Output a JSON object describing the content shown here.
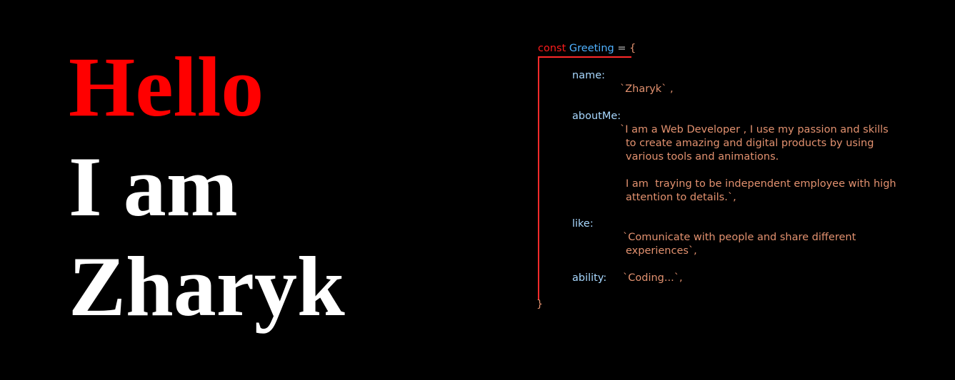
{
  "hero": {
    "line1": "Hello",
    "line2": "I am",
    "line3": "Zharyk"
  },
  "code": {
    "keyword": "const",
    "identifier": "Greeting",
    "operator": " = ",
    "open_brace": "{",
    "close_brace": "}",
    "name_key": "name:",
    "name_value": "`Zharyk` ,",
    "about_key": "aboutMe:",
    "about_lines": [
      "`I am a Web Developer , I use my passion and skills",
      "to create amazing and digital products by using",
      "various tools and animations.",
      "I am  traying to be independent employee with high",
      "attention to details.`,"
    ],
    "like_key": "like:",
    "like_lines": [
      "`Comunicate with people and share different",
      "experiences`,"
    ],
    "ability_key": "ability:",
    "ability_value": "`Coding...`,"
  },
  "colors": {
    "background": "#000000",
    "hello": "#ff0000",
    "text": "#ffffff",
    "keyword": "#ff1c1c",
    "identifier": "#4fb1ff",
    "key": "#a8d8ff",
    "string": "#e2916f"
  }
}
